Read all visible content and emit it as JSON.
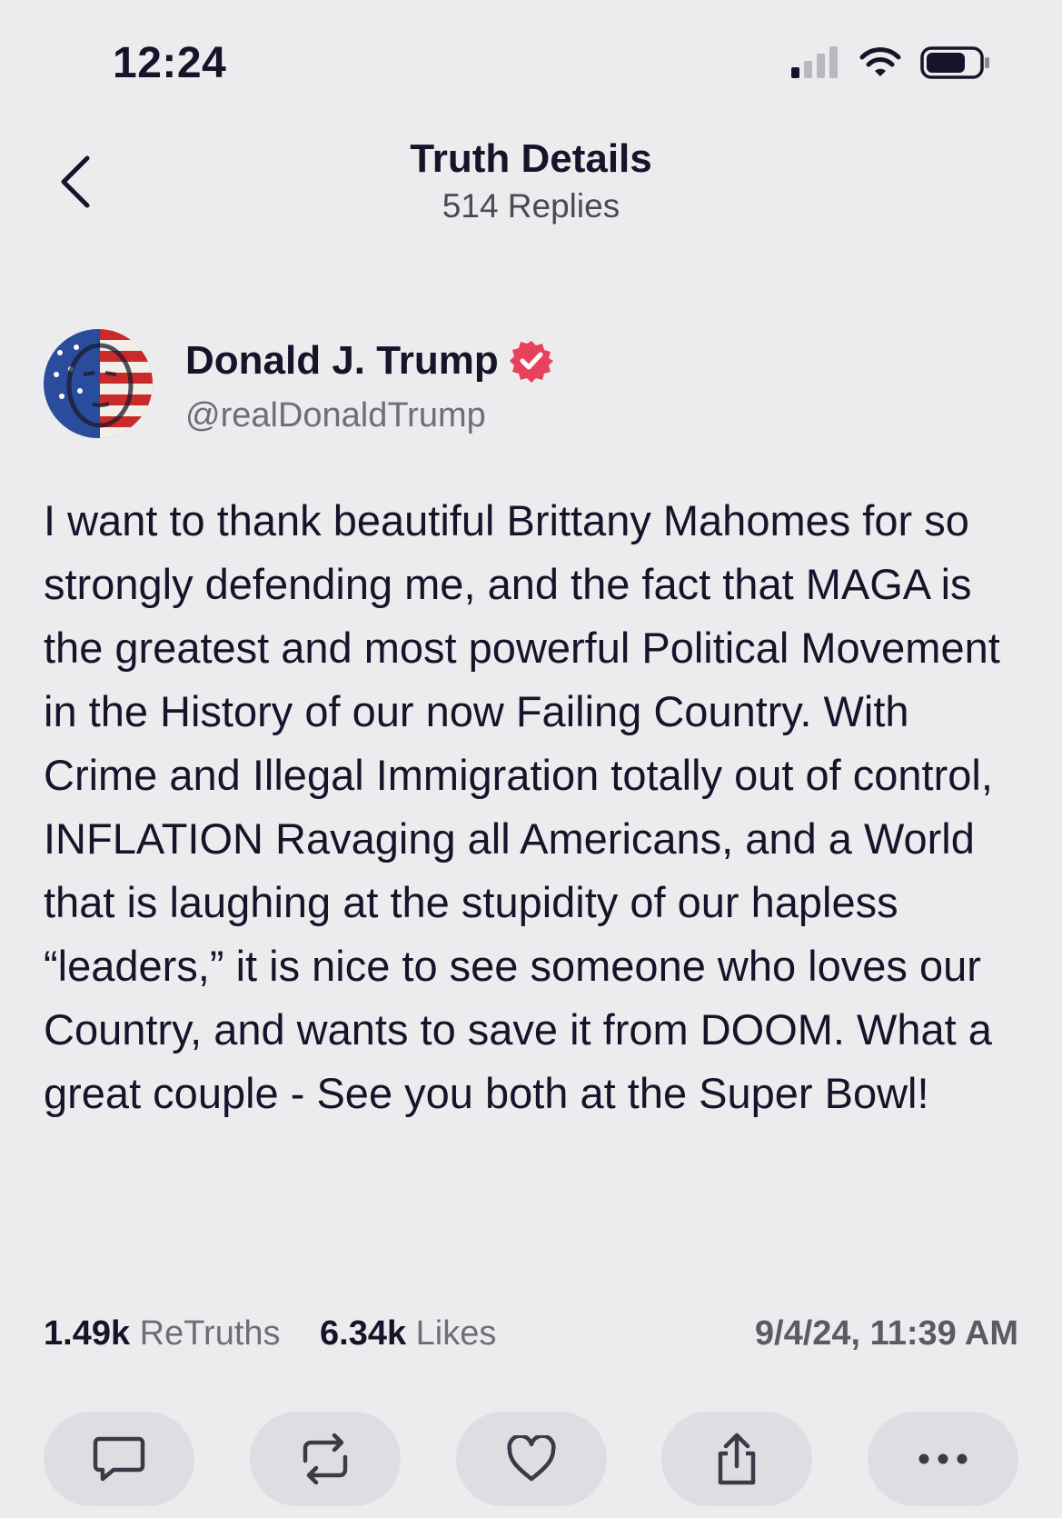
{
  "status_bar": {
    "time": "12:24"
  },
  "header": {
    "title": "Truth Details",
    "subtitle": "514 Replies"
  },
  "author": {
    "name": "Donald J. Trump",
    "handle": "@realDonaldTrump"
  },
  "post": {
    "text": "I want to thank beautiful Brittany Mahomes for so strongly defending me, and the fact that MAGA is the greatest and most powerful Political Movement in the History of our now Failing Country. With Crime and Illegal Immigration totally out of control, INFLATION Ravaging all Americans, and a World that is laughing at the stupidity of our hapless “leaders,” it is nice to see someone who loves our Country, and wants to save it from DOOM. What a great couple - See you both at the Super Bowl!"
  },
  "stats": {
    "retruths_count": "1.49k",
    "retruths_label": "ReTruths",
    "likes_count": "6.34k",
    "likes_label": "Likes",
    "timestamp": "9/4/24, 11:39 AM"
  },
  "icons": {
    "back": "chevron-left-icon",
    "verified": "verified-badge-icon",
    "actions": [
      "comment-icon",
      "retruth-icon",
      "heart-icon",
      "share-icon",
      "more-icon"
    ]
  },
  "colors": {
    "verified": "#e8415b",
    "text": "#16142a",
    "muted": "#6e6e78",
    "button_bg": "#dedee2"
  }
}
